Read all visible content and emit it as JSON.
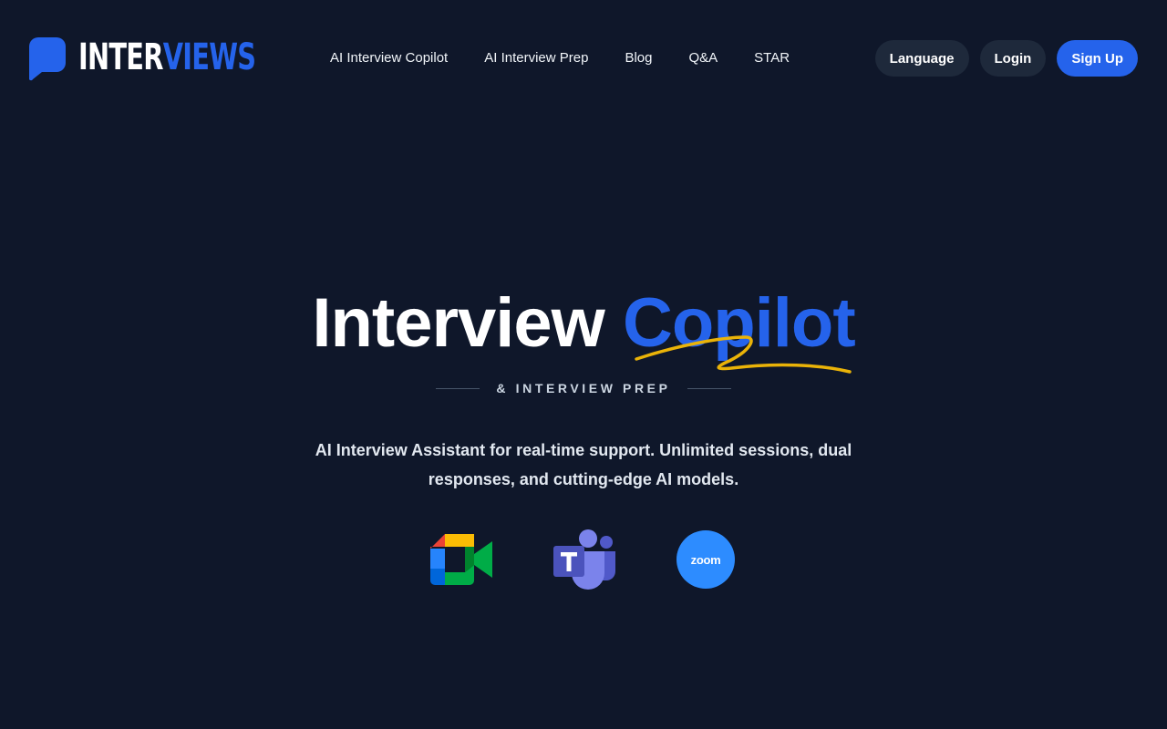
{
  "brand": {
    "name_part1": "INTER",
    "name_part2": "VIEWS",
    "accent_color": "#2563eb"
  },
  "nav": {
    "items": [
      {
        "label": "AI Interview Copilot"
      },
      {
        "label": "AI Interview Prep"
      },
      {
        "label": "Blog"
      },
      {
        "label": "Q&A"
      },
      {
        "label": "STAR"
      }
    ]
  },
  "actions": {
    "language_label": "Language",
    "login_label": "Login",
    "signup_label": "Sign Up"
  },
  "hero": {
    "title_part1": "Interview",
    "title_part2": "Copilot",
    "subtitle": "& INTERVIEW PREP",
    "description": "AI Interview Assistant for real-time support. Unlimited sessions, dual responses, and cutting-edge AI models.",
    "underline_color": "#eab308"
  },
  "platforms": [
    {
      "name": "Google Meet",
      "icon": "google-meet-icon"
    },
    {
      "name": "Microsoft Teams",
      "icon": "microsoft-teams-icon"
    },
    {
      "name": "Zoom",
      "icon": "zoom-icon",
      "label": "zoom"
    }
  ]
}
